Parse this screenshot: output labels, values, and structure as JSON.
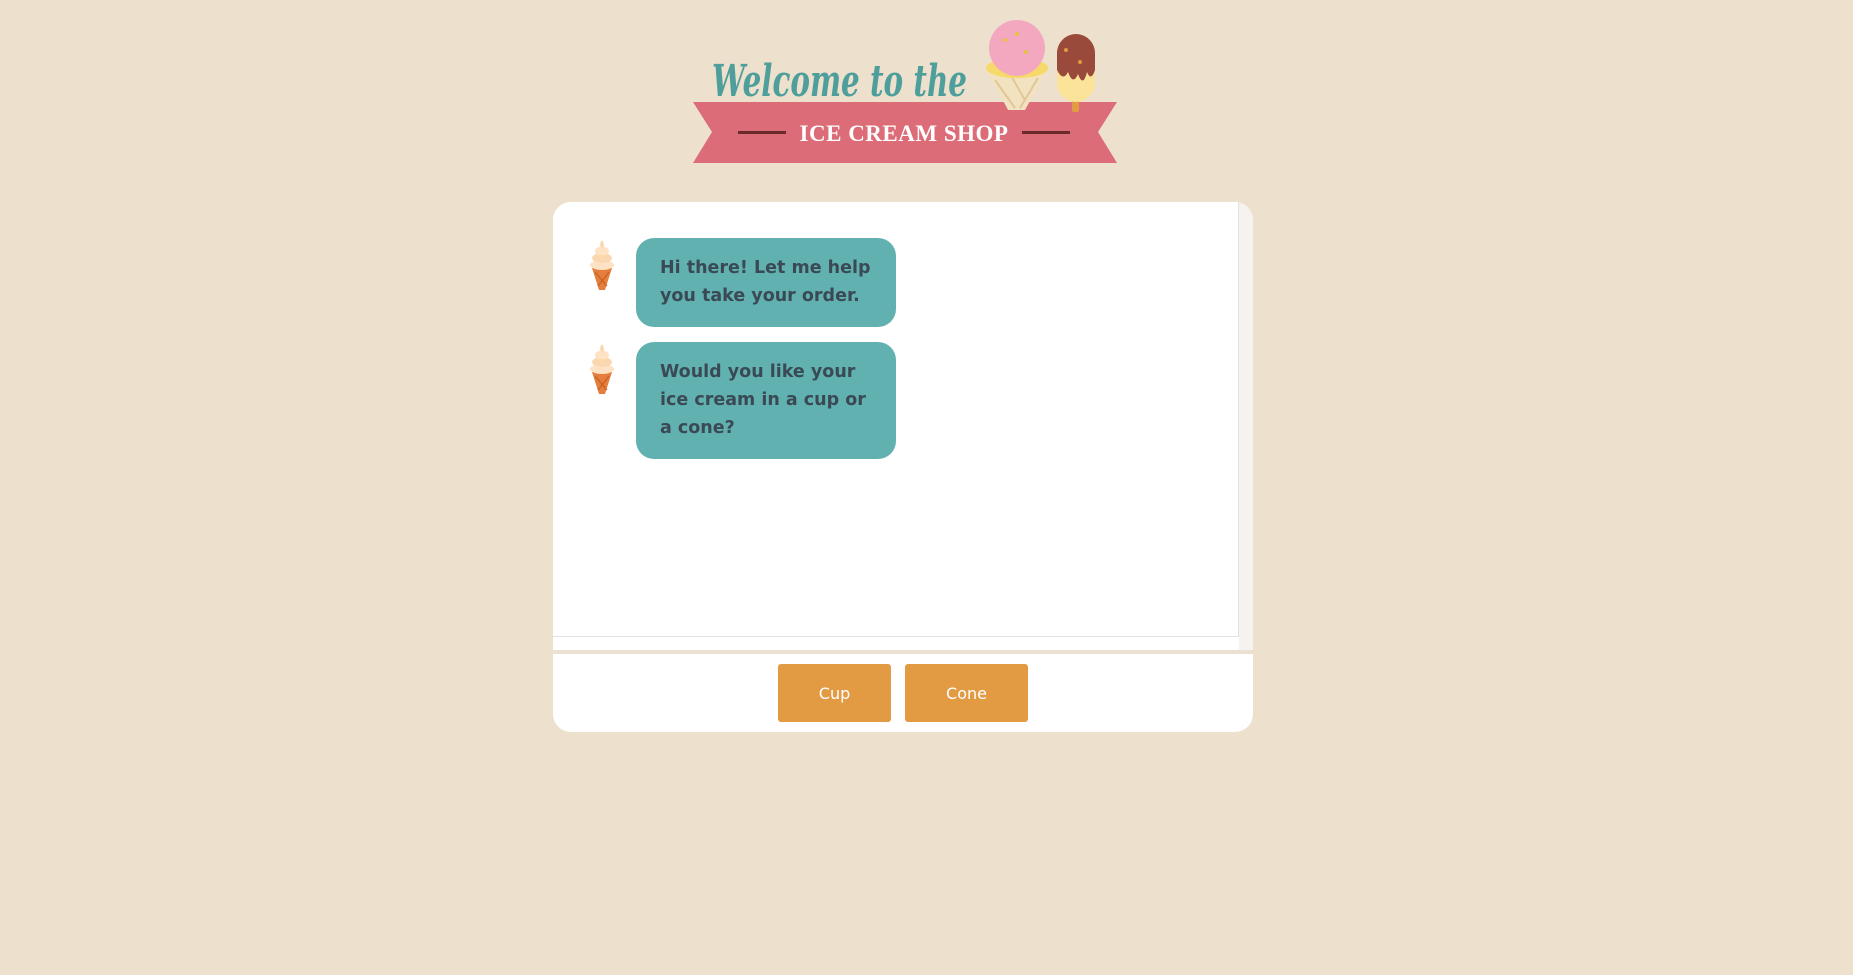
{
  "header": {
    "welcome": "Welcome to the",
    "banner": "ICE CREAM SHOP"
  },
  "colors": {
    "page_background": "#ede0cd",
    "welcome_teal": "#4e9e9c",
    "banner_pink": "#dc6c77",
    "bubble_teal": "#62b1b1",
    "button_orange": "#e39b43",
    "bubble_text": "#3a4a55"
  },
  "chat": {
    "messages": [
      {
        "sender": "bot",
        "avatar_icon": "soft-serve-cone-icon",
        "text": "Hi there! Let me help you take your order."
      },
      {
        "sender": "bot",
        "avatar_icon": "soft-serve-cone-icon",
        "text": "Would you like your ice cream in a cup or a cone?"
      }
    ]
  },
  "choices": {
    "cup_label": "Cup",
    "cone_label": "Cone"
  }
}
